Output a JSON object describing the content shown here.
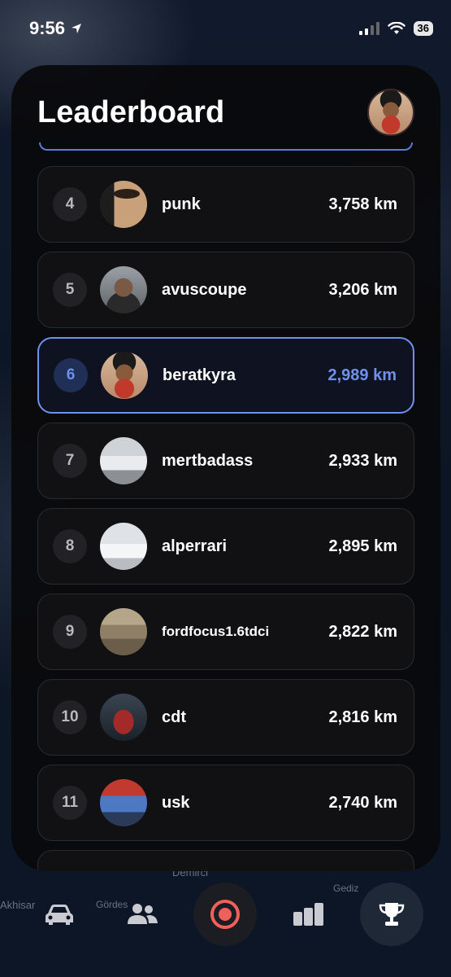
{
  "status_bar": {
    "time": "9:56",
    "battery": "36"
  },
  "map": {
    "labels": [
      "Demirci",
      "Akhisar",
      "Gördes",
      "Gediz"
    ]
  },
  "header": {
    "title": "Leaderboard"
  },
  "leaderboard": {
    "rows": [
      {
        "rank": "4",
        "name": "punk",
        "distance": "3,758 km",
        "avatar": "punk"
      },
      {
        "rank": "5",
        "name": "avuscoupe",
        "distance": "3,206 km",
        "avatar": "avus"
      },
      {
        "rank": "6",
        "name": "beratkyra",
        "distance": "2,989 km",
        "avatar": "face",
        "current_user": true
      },
      {
        "rank": "7",
        "name": "mertbadass",
        "distance": "2,933 km",
        "avatar": "mert"
      },
      {
        "rank": "8",
        "name": "alperrari",
        "distance": "2,895 km",
        "avatar": "alper"
      },
      {
        "rank": "9",
        "name": "fordfocus1.6tdci",
        "distance": "2,822 km",
        "avatar": "ford"
      },
      {
        "rank": "10",
        "name": "cdt",
        "distance": "2,816 km",
        "avatar": "cdt"
      },
      {
        "rank": "11",
        "name": "usk",
        "distance": "2,740 km",
        "avatar": "usk"
      }
    ]
  },
  "tabbar": {
    "tabs": [
      {
        "icon": "car-icon"
      },
      {
        "icon": "people-icon"
      },
      {
        "icon": "record-target-icon"
      },
      {
        "icon": "bar-chart-icon"
      },
      {
        "icon": "trophy-icon",
        "active": true
      }
    ],
    "colors": {
      "record": "#f0605a",
      "accent": "#6f91ec"
    }
  }
}
